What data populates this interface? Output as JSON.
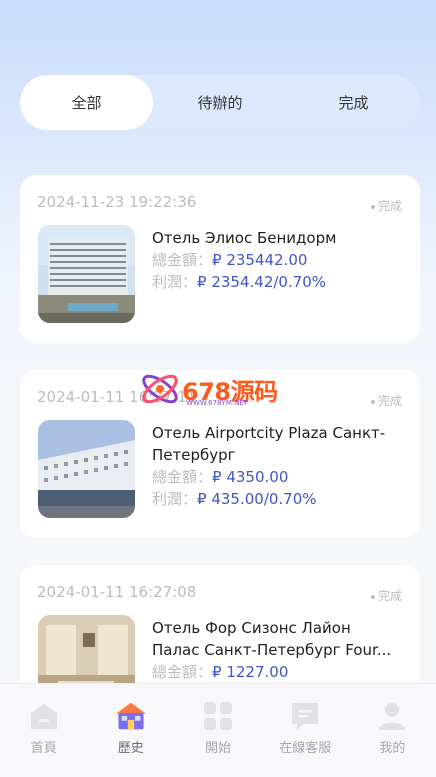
{
  "tabs": [
    {
      "label": "全部",
      "active": true
    },
    {
      "label": "待辦的",
      "active": false
    },
    {
      "label": "完成",
      "active": false
    }
  ],
  "orders": [
    {
      "date": "2024-11-23 19:22:36",
      "status": "完成",
      "name": "Отель Элиос Бенидорм",
      "total_label": "總金額：",
      "total_value": "₽ 235442.00",
      "profit_label": "利潤：",
      "profit_value": "₽ 2354.42/0.70%"
    },
    {
      "date": "2024-01-11 16:27:11",
      "status": "完成",
      "name": "Отель Airportcity Plaza Санкт-Петербург",
      "total_label": "總金額：",
      "total_value": "₽ 4350.00",
      "profit_label": "利潤：",
      "profit_value": "₽ 435.00/0.70%"
    },
    {
      "date": "2024-01-11 16:27:08",
      "status": "完成",
      "name": "Отель Фор Сизонс Лайон Палас Санкт-Петербург Four...",
      "total_label": "總金額：",
      "total_value": "₽ 1227.00"
    }
  ],
  "watermark": {
    "text": "678源码",
    "sub": "WWW.678YM.NET"
  },
  "nav": [
    {
      "label": "首頁",
      "icon": "home-icon",
      "active": false
    },
    {
      "label": "歷史",
      "icon": "history-house-icon",
      "active": true
    },
    {
      "label": "開始",
      "icon": "grid-icon",
      "active": false
    },
    {
      "label": "在線客服",
      "icon": "chat-icon",
      "active": false
    },
    {
      "label": "我的",
      "icon": "user-icon",
      "active": false
    }
  ]
}
